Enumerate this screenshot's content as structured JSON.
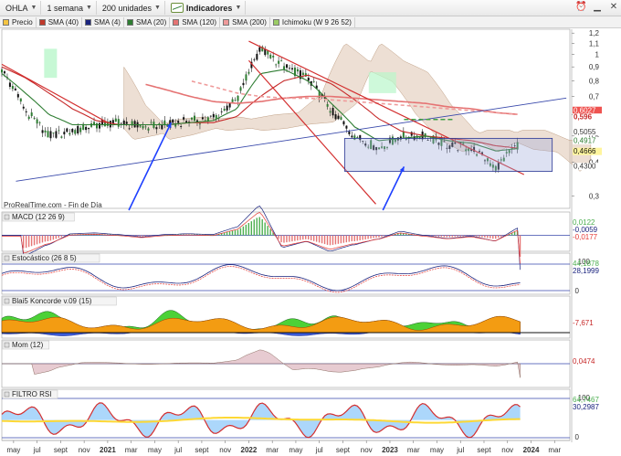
{
  "toolbar": {
    "symbol": "OHLA",
    "period": "1 semana",
    "units": "200 unidades",
    "indicators_label": "Indicadores"
  },
  "legend": [
    {
      "label": "Precio",
      "color": "#f5c542"
    },
    {
      "label": "SMA (40)",
      "color": "#c0392b"
    },
    {
      "label": "SMA (4)",
      "color": "#1a237e"
    },
    {
      "label": "SMA (20)",
      "color": "#2e7d32"
    },
    {
      "label": "SMA (120)",
      "color": "#e57373"
    },
    {
      "label": "SMA (200)",
      "color": "#ef9a9a"
    },
    {
      "label": "Ichimoku (W 9 26 52)",
      "color": "#9ccc65"
    }
  ],
  "watermark": "ProRealTime.com - Fin de Día",
  "price_axis": {
    "ticks": [
      "1,2",
      "1,1",
      "1",
      "0,9",
      "0,8",
      "0,7",
      "0,6",
      "0,5",
      "0,4",
      "0,3"
    ],
    "tags": [
      {
        "label": "0,6027",
        "value": 0.6027,
        "color": "#ef5350",
        "text": "#ffffff"
      },
      {
        "label": "0,596",
        "value": 0.596,
        "color": "#ffffff",
        "text": "#c62828"
      },
      {
        "label": "0,5055",
        "value": 0.5055,
        "color": "#ffffff",
        "text": "#333333"
      },
      {
        "label": "0,4917",
        "value": 0.4917,
        "color": "#ffffff",
        "text": "#2e7d32"
      },
      {
        "label": "0,4666",
        "value": 0.4666,
        "color": "#fff59d",
        "text": "#111111"
      },
      {
        "label": "0,4300",
        "value": 0.43,
        "color": "#ffffff",
        "text": "#333333"
      }
    ]
  },
  "panels": [
    {
      "title": "MACD (12 26 9)",
      "tags": [
        "0,0122",
        "-0,0059",
        "-0,0177"
      ]
    },
    {
      "title": "Estocástico (26 8 5)",
      "ticks": [
        "100",
        "0"
      ],
      "tags": [
        "44,1878",
        "28,1999"
      ]
    },
    {
      "title": "Blai5 Koncorde v.09 (15)",
      "tags": [
        "-7,671"
      ]
    },
    {
      "title": "Mom (12)",
      "tags": [
        "0,0474"
      ]
    },
    {
      "title": "FILTRO RSI",
      "ticks": [
        "100",
        "0"
      ],
      "tags": [
        "64,7467",
        "30,2987"
      ]
    }
  ],
  "x_axis": {
    "ticks": [
      "may",
      "jul",
      "sept",
      "nov",
      "2021",
      "mar",
      "may",
      "jul",
      "sept",
      "nov",
      "2022",
      "mar",
      "may",
      "jul",
      "sept",
      "nov",
      "2023",
      "mar",
      "may",
      "jul",
      "sept",
      "nov",
      "2024",
      "mar"
    ]
  },
  "chart_data": {
    "type": "line",
    "title": "",
    "xlabel": "",
    "ylabel": "",
    "x": [
      "2020-04",
      "2020-06",
      "2020-08",
      "2020-10",
      "2020-12",
      "2021-02",
      "2021-04",
      "2021-06",
      "2021-08",
      "2021-10",
      "2021-12",
      "2022-02",
      "2022-04",
      "2022-06",
      "2022-08",
      "2022-10",
      "2022-12",
      "2023-02",
      "2023-04",
      "2023-06",
      "2023-08",
      "2023-10",
      "2023-12"
    ],
    "ylim": [
      0.27,
      1.24
    ],
    "scale": "log",
    "series": [
      {
        "name": "Precio",
        "values": [
          0.88,
          0.62,
          0.5,
          0.52,
          0.55,
          0.56,
          0.54,
          0.55,
          0.57,
          0.58,
          0.68,
          1.05,
          0.9,
          0.82,
          0.62,
          0.5,
          0.45,
          0.5,
          0.5,
          0.46,
          0.45,
          0.38,
          0.47
        ]
      },
      {
        "name": "SMA (40)",
        "values": [
          0.9,
          0.82,
          0.72,
          0.63,
          0.57,
          0.55,
          0.55,
          0.55,
          0.56,
          0.56,
          0.59,
          0.7,
          0.8,
          0.84,
          0.78,
          0.68,
          0.58,
          0.52,
          0.5,
          0.49,
          0.48,
          0.46,
          0.45
        ]
      },
      {
        "name": "SMA (20)",
        "values": [
          0.85,
          0.72,
          0.6,
          0.55,
          0.55,
          0.55,
          0.55,
          0.55,
          0.56,
          0.57,
          0.63,
          0.85,
          0.88,
          0.8,
          0.66,
          0.54,
          0.48,
          0.49,
          0.5,
          0.48,
          0.47,
          0.44,
          0.45
        ]
      },
      {
        "name": "SMA (120)",
        "values": [
          null,
          null,
          null,
          null,
          null,
          null,
          0.78,
          0.74,
          0.7,
          0.67,
          0.66,
          0.67,
          0.69,
          0.7,
          0.7,
          0.69,
          0.68,
          0.67,
          0.66,
          0.64,
          0.63,
          0.61,
          0.6
        ]
      },
      {
        "name": "SMA (200)",
        "values": [
          null,
          null,
          null,
          null,
          null,
          null,
          null,
          null,
          0.8,
          0.76,
          0.72,
          0.7,
          0.69,
          0.69,
          0.68,
          0.67,
          0.66,
          0.65,
          0.64,
          0.63,
          0.62,
          0.61,
          0.6
        ]
      }
    ],
    "legend_position": "top-left",
    "grid": false
  }
}
